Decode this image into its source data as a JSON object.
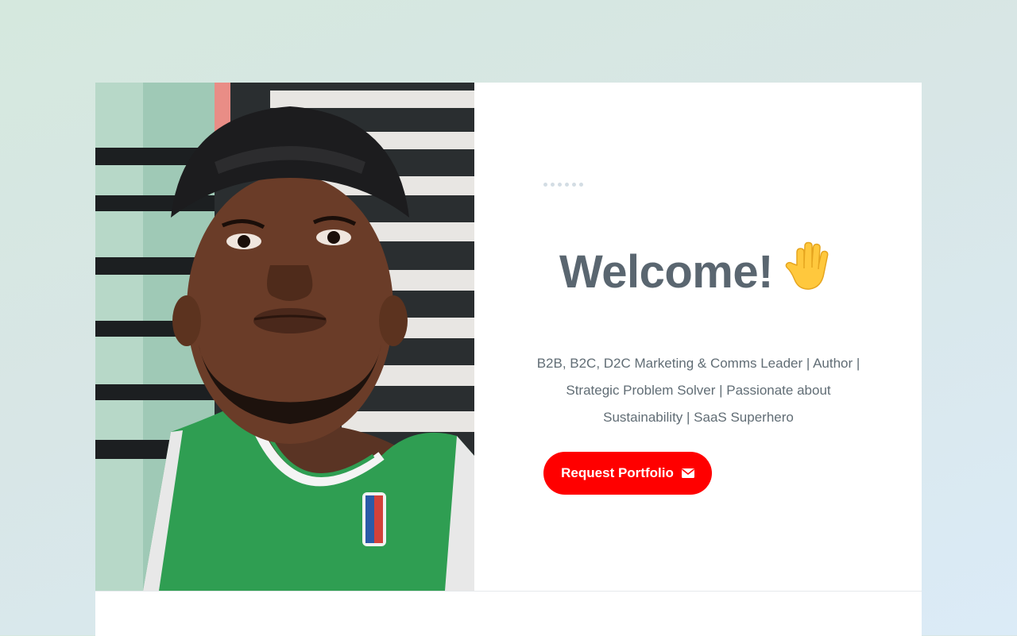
{
  "hero": {
    "photo_alt": "Profile photo",
    "heading": "Welcome!",
    "bio_lines": [
      "B2B, B2C, D2C Marketing & Comms Leader | Author |",
      "Strategic Problem Solver | Passionate about",
      "Sustainability | SaaS Superhero"
    ],
    "cta_label": "Request Portfolio",
    "cta_icon": "envelope-icon",
    "heading_icon": "raised-hand-emoji"
  },
  "colors": {
    "accent": "#ff0000",
    "heading": "#5a6670",
    "body_text": "#616d75",
    "dots": "#d3dde4"
  }
}
